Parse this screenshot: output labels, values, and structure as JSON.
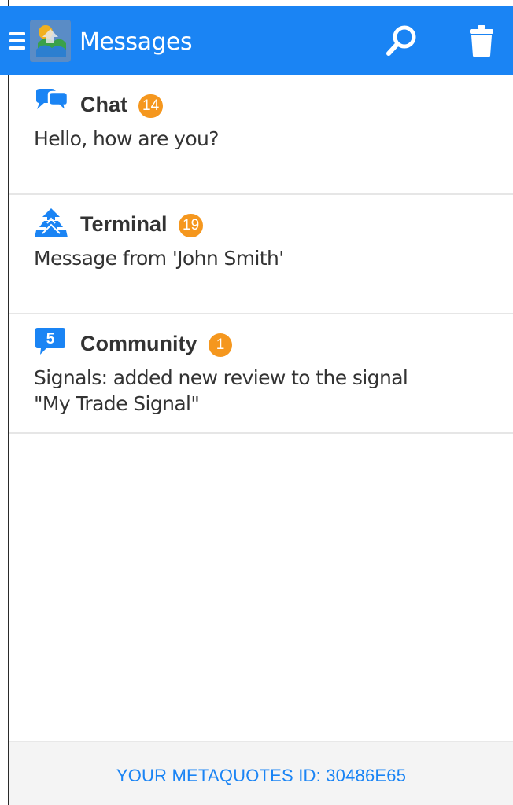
{
  "header": {
    "title": "Messages",
    "menu_icon": "hamburger-icon",
    "logo_icon": "metatrader-logo-icon",
    "search_icon": "search-icon",
    "delete_icon": "trash-icon",
    "accent_color": "#1a84f4"
  },
  "messages": [
    {
      "category": "Chat",
      "icon": "chat-bubbles-icon",
      "badge": "14",
      "lines": [
        "Hello, how are you?"
      ]
    },
    {
      "category": "Terminal",
      "icon": "terminal-logo-icon",
      "badge": "19",
      "lines": [
        "Message from 'John Smith'"
      ]
    },
    {
      "category": "Community",
      "icon": "community-icon",
      "icon_label": "5",
      "badge": "1",
      "lines": [
        "Signals: added new review to the signal",
        "\"My Trade Signal\""
      ]
    }
  ],
  "badge_color": "#f5971e",
  "footer": {
    "metaquotes_id": "YOUR METAQUOTES ID: 30486E65"
  }
}
